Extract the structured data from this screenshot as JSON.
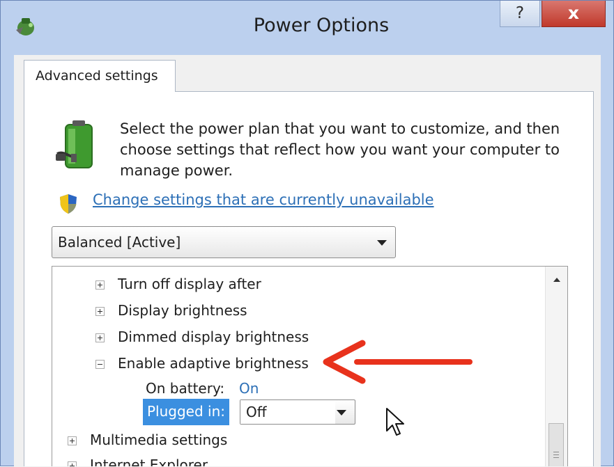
{
  "window": {
    "title": "Power Options",
    "help_label": "?",
    "close_label": "x"
  },
  "tab": {
    "label": "Advanced settings"
  },
  "description": "Select the power plan that you want to customize, and then choose settings that reflect how you want your computer to manage power.",
  "change_link": "Change settings that are currently unavailable",
  "plan_select": {
    "value": "Balanced [Active]"
  },
  "tree": {
    "items": [
      {
        "label": "Turn off display after",
        "expander": "plus"
      },
      {
        "label": "Display brightness",
        "expander": "plus"
      },
      {
        "label": "Dimmed display brightness",
        "expander": "plus"
      },
      {
        "label": "Enable adaptive brightness",
        "expander": "minus"
      }
    ],
    "on_battery": {
      "label": "On battery:",
      "value": "On"
    },
    "plugged_in": {
      "label": "Plugged in:",
      "value": "Off"
    },
    "multimedia": {
      "label": "Multimedia settings",
      "expander": "plus"
    },
    "internet_explorer": {
      "label": "Internet Explorer",
      "expander": "plus"
    }
  },
  "colors": {
    "link": "#2c6fb6",
    "selection": "#3b8fe0",
    "close": "#c0392b",
    "arrow": "#e8321c",
    "frame": "#bcd0ee"
  },
  "icons": [
    "power-plan-app-icon",
    "help-icon",
    "close-icon",
    "battery-plug-icon",
    "uac-shield-icon",
    "dropdown-arrow-icon",
    "expander-plus-icon",
    "expander-minus-icon",
    "scroll-up-icon",
    "red-arrow-annotation",
    "mouse-cursor-icon"
  ]
}
